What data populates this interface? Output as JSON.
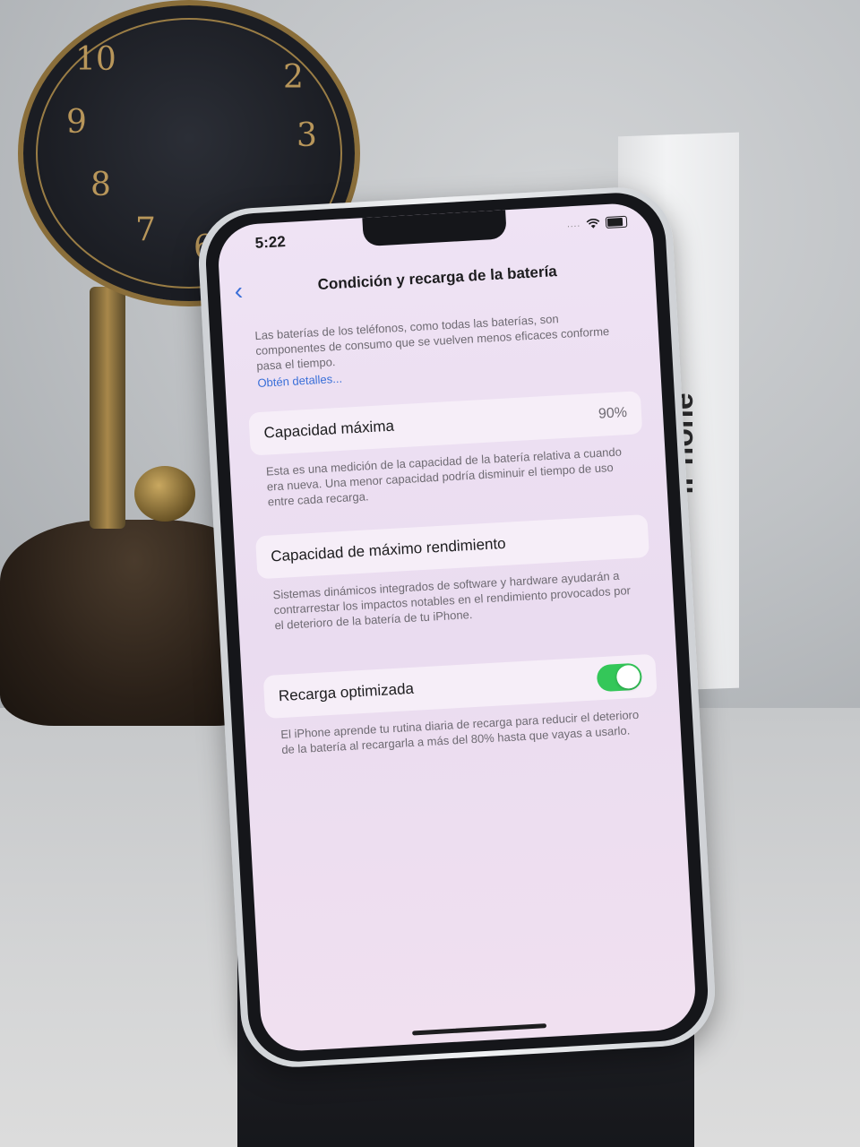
{
  "status_bar": {
    "time": "5:22",
    "signal": "....",
    "icons": [
      "wifi-icon",
      "battery-icon"
    ]
  },
  "nav": {
    "back_icon": "chevron-left-icon",
    "title": "Condición y recarga de la batería"
  },
  "intro": {
    "text": "Las baterías de los teléfonos, como todas las baterías, son componentes de consumo que se vuelven menos eficaces conforme pasa el tiempo.",
    "link": "Obtén detalles..."
  },
  "max_capacity": {
    "label": "Capacidad máxima",
    "value": "90%",
    "note": "Esta es una medición de la capacidad de la batería relativa a cuando era nueva. Una menor capacidad podría disminuir el tiempo de uso entre cada recarga."
  },
  "peak_performance": {
    "label": "Capacidad de máximo rendimiento",
    "note": "Sistemas dinámicos integrados de software y hardware ayudarán a contrarrestar los impactos notables en el rendimiento provocados por el deterioro de la batería de tu iPhone."
  },
  "optimized_charging": {
    "label": "Recarga optimizada",
    "enabled": true,
    "note": "El iPhone aprende tu rutina diaria de recarga para reducir el deterioro de la batería al recargarla a más del 80% hasta que vayas a usarlo."
  },
  "scene": {
    "box_label": "iPhone",
    "clock_numerals": [
      "10",
      "2",
      "3",
      "9",
      "8",
      "7",
      "6"
    ]
  },
  "colors": {
    "accent": "#3a6fd8",
    "toggle_on": "#34c759",
    "screen_bg": "#eadcf0"
  }
}
